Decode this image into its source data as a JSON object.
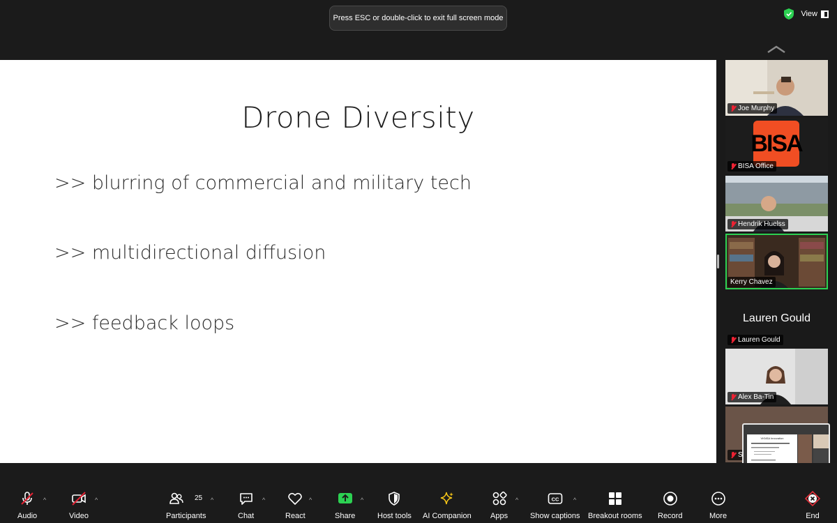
{
  "banner": {
    "text": "Press ESC or double-click to exit full screen mode"
  },
  "top_right": {
    "view_label": "View",
    "shield_color": "#2cd152"
  },
  "slide": {
    "title": "Drone Diversity",
    "bullets": [
      ">> blurring of commercial and military tech",
      ">> multidirectional diffusion",
      ">> feedback loops"
    ]
  },
  "gallery": {
    "tiles": [
      {
        "name": "Joe Murphy",
        "muted": true,
        "active": false,
        "type": "video"
      },
      {
        "name": "BISA Office",
        "muted": true,
        "active": false,
        "type": "logo",
        "logo_text": "BISA",
        "logo_color": "#f04e23"
      },
      {
        "name": "Hendrik Huelss",
        "muted": true,
        "active": false,
        "type": "video"
      },
      {
        "name": "Kerry Chavez",
        "muted": false,
        "active": true,
        "type": "video"
      },
      {
        "name": "Lauren Gould",
        "muted": true,
        "active": false,
        "type": "name-only",
        "big_name": "Lauren Gould"
      },
      {
        "name": "Alex Ba-Tin",
        "muted": true,
        "active": false,
        "type": "video"
      },
      {
        "name": "S",
        "muted": true,
        "active": false,
        "type": "video"
      }
    ]
  },
  "self_view": {
    "slide_title": "VKNSA Innovation"
  },
  "toolbar": {
    "audio": "Audio",
    "video": "Video",
    "participants": "Participants",
    "participants_count": "25",
    "chat": "Chat",
    "react": "React",
    "share": "Share",
    "host_tools": "Host tools",
    "ai_companion": "AI Companion",
    "apps": "Apps",
    "show_captions": "Show captions",
    "captions_glyph": "CC",
    "breakout_rooms": "Breakout rooms",
    "record": "Record",
    "more": "More",
    "end": "End"
  },
  "colors": {
    "share_green": "#2cd152",
    "end_red": "#e5303a",
    "ai_yellow": "#f5c518",
    "muted_red": "#e22233"
  }
}
